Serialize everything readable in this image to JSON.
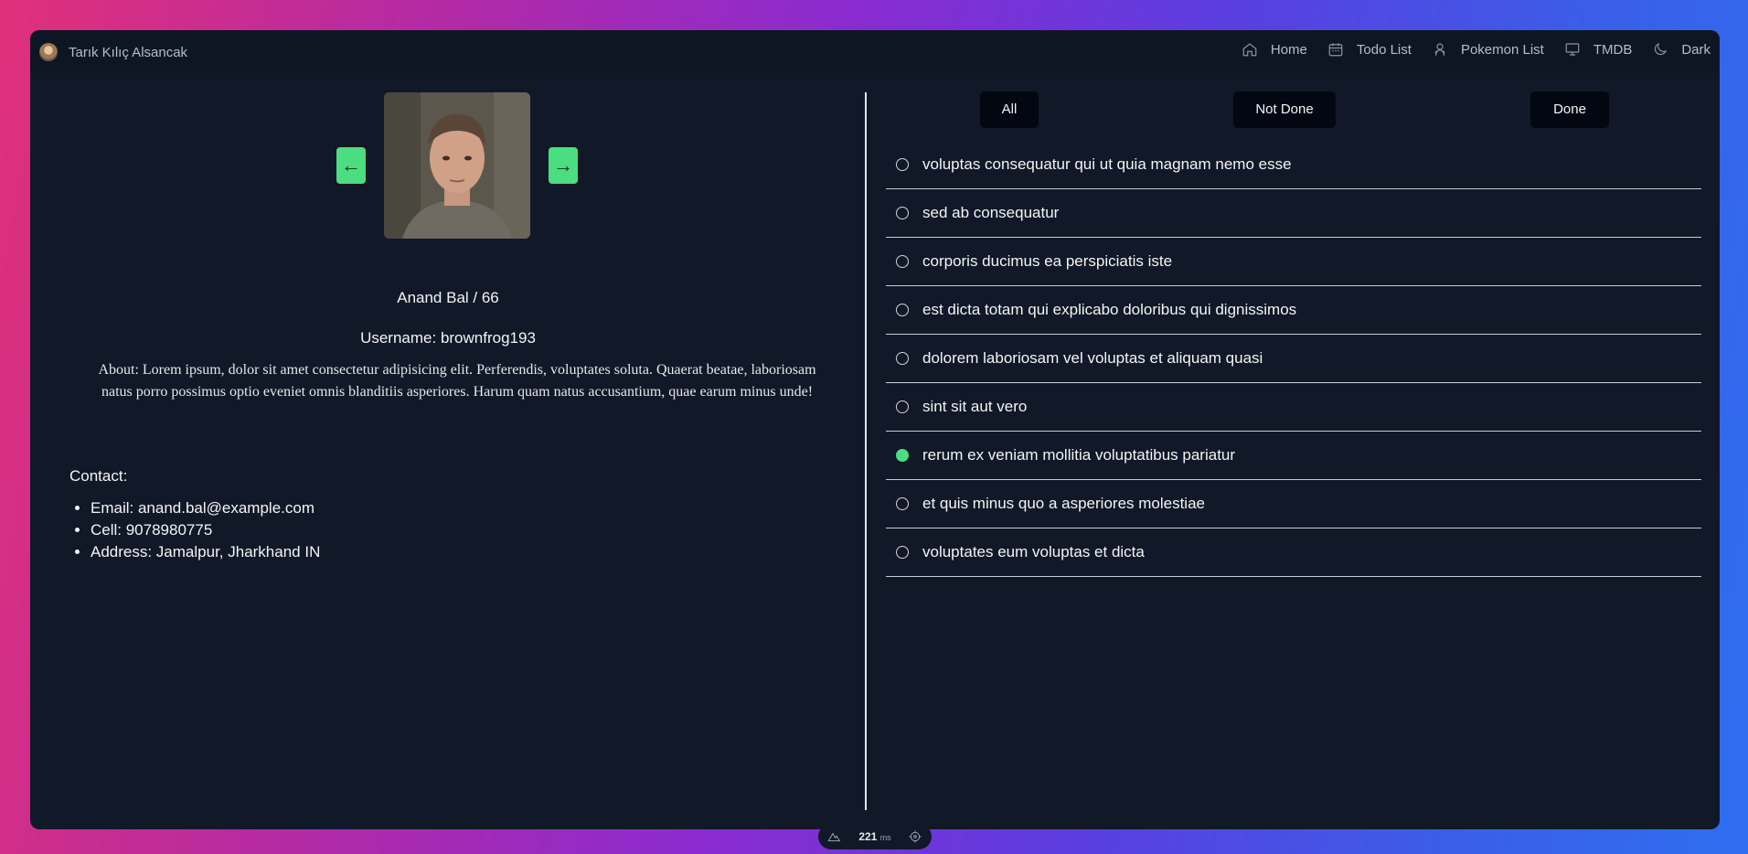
{
  "brand": {
    "name": "Tarık Kılıç Alsancak"
  },
  "nav": [
    {
      "label": "Home",
      "icon": "home-icon"
    },
    {
      "label": "Todo List",
      "icon": "calendar-icon"
    },
    {
      "label": "Pokemon List",
      "icon": "pokemon-icon"
    },
    {
      "label": "TMDB",
      "icon": "monitor-icon"
    },
    {
      "label": "Dark",
      "icon": "moon-icon"
    }
  ],
  "profile": {
    "prev_label": "←",
    "next_label": "→",
    "name_age": "Anand Bal / 66",
    "username": "Username: brownfrog193",
    "about": "About: Lorem ipsum, dolor sit amet consectetur adipisicing elit. Perferendis, voluptates soluta. Quaerat beatae, laboriosam natus porro possimus optio eveniet omnis blanditiis asperiores. Harum quam natus accusantium, quae earum minus unde!",
    "contact_title": "Contact:",
    "email": "Email: anand.bal@example.com",
    "cell": "Cell: 9078980775",
    "address": "Address: Jamalpur, Jharkhand IN"
  },
  "filters": {
    "all": "All",
    "not_done": "Not Done",
    "done": "Done"
  },
  "todos": [
    {
      "text": "voluptas consequatur qui ut quia magnam nemo esse",
      "done": false
    },
    {
      "text": "sed ab consequatur",
      "done": false
    },
    {
      "text": "corporis ducimus ea perspiciatis iste",
      "done": false
    },
    {
      "text": "est dicta totam qui explicabo doloribus qui dignissimos",
      "done": false
    },
    {
      "text": "dolorem laboriosam vel voluptas et aliquam quasi",
      "done": false
    },
    {
      "text": "sint sit aut vero",
      "done": false
    },
    {
      "text": "rerum ex veniam mollitia voluptatibus pariatur",
      "done": true
    },
    {
      "text": "et quis minus quo a asperiores molestiae",
      "done": false
    },
    {
      "text": "voluptates eum voluptas et dicta",
      "done": false
    }
  ],
  "devbar": {
    "ms_value": "221",
    "ms_unit": "ms"
  },
  "colors": {
    "accent": "#4ade80",
    "window_bg": "#111827",
    "button_bg": "#030712"
  }
}
